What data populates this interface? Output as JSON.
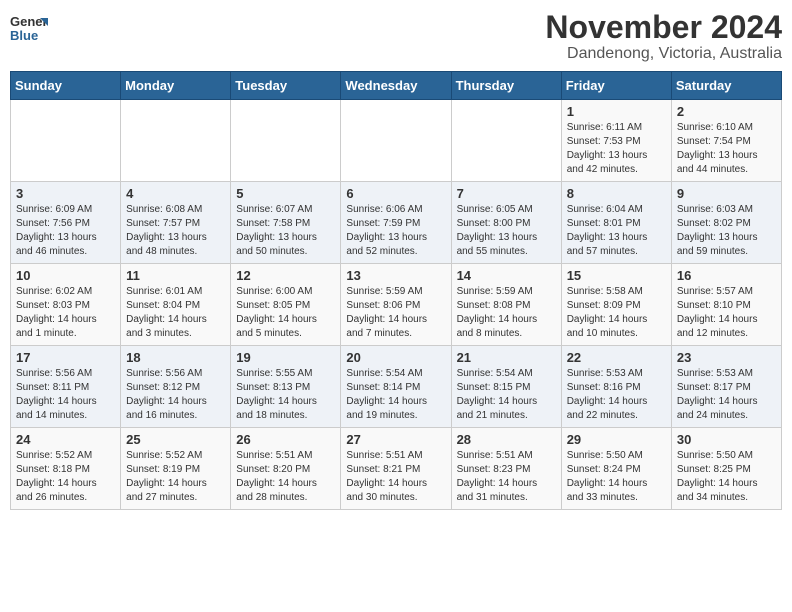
{
  "header": {
    "logo_general": "General",
    "logo_blue": "Blue",
    "title": "November 2024",
    "subtitle": "Dandenong, Victoria, Australia"
  },
  "weekdays": [
    "Sunday",
    "Monday",
    "Tuesday",
    "Wednesday",
    "Thursday",
    "Friday",
    "Saturday"
  ],
  "weeks": [
    [
      {
        "day": "",
        "info": ""
      },
      {
        "day": "",
        "info": ""
      },
      {
        "day": "",
        "info": ""
      },
      {
        "day": "",
        "info": ""
      },
      {
        "day": "",
        "info": ""
      },
      {
        "day": "1",
        "info": "Sunrise: 6:11 AM\nSunset: 7:53 PM\nDaylight: 13 hours\nand 42 minutes."
      },
      {
        "day": "2",
        "info": "Sunrise: 6:10 AM\nSunset: 7:54 PM\nDaylight: 13 hours\nand 44 minutes."
      }
    ],
    [
      {
        "day": "3",
        "info": "Sunrise: 6:09 AM\nSunset: 7:56 PM\nDaylight: 13 hours\nand 46 minutes."
      },
      {
        "day": "4",
        "info": "Sunrise: 6:08 AM\nSunset: 7:57 PM\nDaylight: 13 hours\nand 48 minutes."
      },
      {
        "day": "5",
        "info": "Sunrise: 6:07 AM\nSunset: 7:58 PM\nDaylight: 13 hours\nand 50 minutes."
      },
      {
        "day": "6",
        "info": "Sunrise: 6:06 AM\nSunset: 7:59 PM\nDaylight: 13 hours\nand 52 minutes."
      },
      {
        "day": "7",
        "info": "Sunrise: 6:05 AM\nSunset: 8:00 PM\nDaylight: 13 hours\nand 55 minutes."
      },
      {
        "day": "8",
        "info": "Sunrise: 6:04 AM\nSunset: 8:01 PM\nDaylight: 13 hours\nand 57 minutes."
      },
      {
        "day": "9",
        "info": "Sunrise: 6:03 AM\nSunset: 8:02 PM\nDaylight: 13 hours\nand 59 minutes."
      }
    ],
    [
      {
        "day": "10",
        "info": "Sunrise: 6:02 AM\nSunset: 8:03 PM\nDaylight: 14 hours\nand 1 minute."
      },
      {
        "day": "11",
        "info": "Sunrise: 6:01 AM\nSunset: 8:04 PM\nDaylight: 14 hours\nand 3 minutes."
      },
      {
        "day": "12",
        "info": "Sunrise: 6:00 AM\nSunset: 8:05 PM\nDaylight: 14 hours\nand 5 minutes."
      },
      {
        "day": "13",
        "info": "Sunrise: 5:59 AM\nSunset: 8:06 PM\nDaylight: 14 hours\nand 7 minutes."
      },
      {
        "day": "14",
        "info": "Sunrise: 5:59 AM\nSunset: 8:08 PM\nDaylight: 14 hours\nand 8 minutes."
      },
      {
        "day": "15",
        "info": "Sunrise: 5:58 AM\nSunset: 8:09 PM\nDaylight: 14 hours\nand 10 minutes."
      },
      {
        "day": "16",
        "info": "Sunrise: 5:57 AM\nSunset: 8:10 PM\nDaylight: 14 hours\nand 12 minutes."
      }
    ],
    [
      {
        "day": "17",
        "info": "Sunrise: 5:56 AM\nSunset: 8:11 PM\nDaylight: 14 hours\nand 14 minutes."
      },
      {
        "day": "18",
        "info": "Sunrise: 5:56 AM\nSunset: 8:12 PM\nDaylight: 14 hours\nand 16 minutes."
      },
      {
        "day": "19",
        "info": "Sunrise: 5:55 AM\nSunset: 8:13 PM\nDaylight: 14 hours\nand 18 minutes."
      },
      {
        "day": "20",
        "info": "Sunrise: 5:54 AM\nSunset: 8:14 PM\nDaylight: 14 hours\nand 19 minutes."
      },
      {
        "day": "21",
        "info": "Sunrise: 5:54 AM\nSunset: 8:15 PM\nDaylight: 14 hours\nand 21 minutes."
      },
      {
        "day": "22",
        "info": "Sunrise: 5:53 AM\nSunset: 8:16 PM\nDaylight: 14 hours\nand 22 minutes."
      },
      {
        "day": "23",
        "info": "Sunrise: 5:53 AM\nSunset: 8:17 PM\nDaylight: 14 hours\nand 24 minutes."
      }
    ],
    [
      {
        "day": "24",
        "info": "Sunrise: 5:52 AM\nSunset: 8:18 PM\nDaylight: 14 hours\nand 26 minutes."
      },
      {
        "day": "25",
        "info": "Sunrise: 5:52 AM\nSunset: 8:19 PM\nDaylight: 14 hours\nand 27 minutes."
      },
      {
        "day": "26",
        "info": "Sunrise: 5:51 AM\nSunset: 8:20 PM\nDaylight: 14 hours\nand 28 minutes."
      },
      {
        "day": "27",
        "info": "Sunrise: 5:51 AM\nSunset: 8:21 PM\nDaylight: 14 hours\nand 30 minutes."
      },
      {
        "day": "28",
        "info": "Sunrise: 5:51 AM\nSunset: 8:23 PM\nDaylight: 14 hours\nand 31 minutes."
      },
      {
        "day": "29",
        "info": "Sunrise: 5:50 AM\nSunset: 8:24 PM\nDaylight: 14 hours\nand 33 minutes."
      },
      {
        "day": "30",
        "info": "Sunrise: 5:50 AM\nSunset: 8:25 PM\nDaylight: 14 hours\nand 34 minutes."
      }
    ]
  ]
}
